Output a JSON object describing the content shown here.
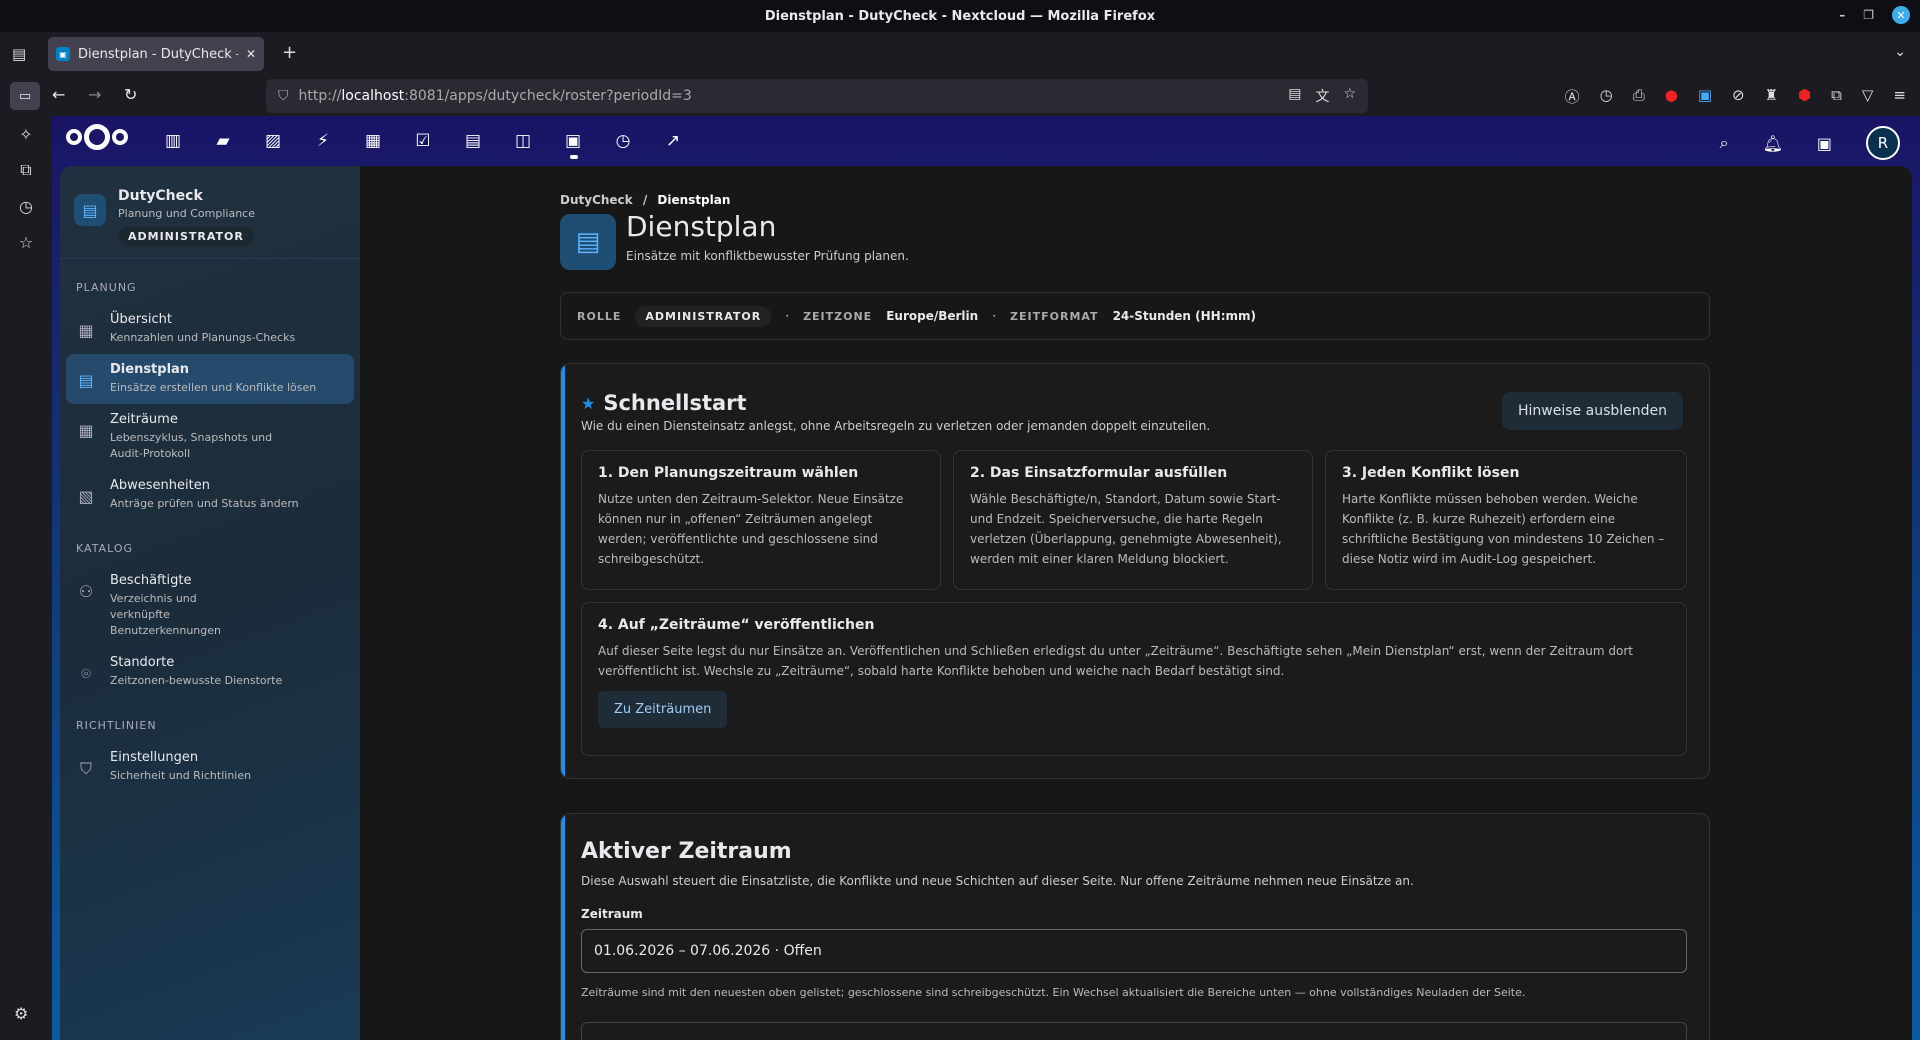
{
  "window": {
    "title": "Dienstplan - DutyCheck - Nextcloud — Mozilla Firefox"
  },
  "browser": {
    "tab_title": "Dienstplan - DutyCheck - Nextcloud",
    "url_prefix": "http://",
    "url_host": "localhost",
    "url_rest": ":8081/apps/dutycheck/roster?periodId=3"
  },
  "app": {
    "name": "DutyCheck",
    "subtitle": "Planung und Compliance",
    "role": "ADMINISTRATOR"
  },
  "sidebar": {
    "sections": {
      "planung": "PLANUNG",
      "katalog": "KATALOG",
      "richtlinien": "RICHTLINIEN"
    },
    "items": [
      {
        "label": "Übersicht",
        "desc": "Kennzahlen und Planungs-Checks"
      },
      {
        "label": "Dienstplan",
        "desc": "Einsätze erstellen und Konflikte lösen"
      },
      {
        "label": "Zeiträume",
        "desc": "Lebenszyklus, Snapshots und Audit-Protokoll"
      },
      {
        "label": "Abwesenheiten",
        "desc": "Anträge prüfen und Status ändern"
      },
      {
        "label": "Beschäftigte",
        "desc": "Verzeichnis und verknüpfte Benutzerkennungen"
      },
      {
        "label": "Standorte",
        "desc": "Zeitzonen-bewusste Dienstorte"
      },
      {
        "label": "Einstellungen",
        "desc": "Sicherheit und Richtlinien"
      }
    ]
  },
  "breadcrumb": {
    "root": "DutyCheck",
    "sep": "/",
    "current": "Dienstplan"
  },
  "page": {
    "title": "Dienstplan",
    "subtitle": "Einsätze mit konfliktbewusster Prüfung planen."
  },
  "rolebar": {
    "role_key": "ROLLE",
    "role_val": "ADMINISTRATOR",
    "tz_key": "ZEITZONE",
    "tz_val": "Europe/Berlin",
    "tf_key": "ZEITFORMAT",
    "tf_val": "24-Stunden (HH:mm)",
    "dot": "·"
  },
  "quickstart": {
    "title": "Schnellstart",
    "subtitle": "Wie du einen Diensteinsatz anlegst, ohne Arbeitsregeln zu verletzen oder jemanden doppelt einzuteilen.",
    "hide_button": "Hinweise ausblenden",
    "steps": [
      {
        "title": "1. Den Planungszeitraum wählen",
        "text": "Nutze unten den Zeitraum-Selektor. Neue Einsätze können nur in „offenen“ Zeiträumen angelegt werden; veröffentlichte und geschlossene sind schreibgeschützt."
      },
      {
        "title": "2. Das Einsatzformular ausfüllen",
        "text": "Wähle Beschäftigte/n, Standort, Datum sowie Start- und Endzeit. Speicherversuche, die harte Regeln verletzen (Überlappung, genehmigte Abwesenheit), werden mit einer klaren Meldung blockiert."
      },
      {
        "title": "3. Jeden Konflikt lösen",
        "text": "Harte Konflikte müssen behoben werden. Weiche Konflikte (z. B. kurze Ruhezeit) erfordern eine schriftliche Bestätigung von mindestens 10 Zeichen – diese Notiz wird im Audit-Log gespeichert."
      },
      {
        "title": "4. Auf „Zeiträume“ veröffentlichen",
        "text": "Auf dieser Seite legst du nur Einsätze an. Veröffentlichen und Schließen erledigst du unter „Zeiträume“. Beschäftigte sehen „Mein Dienstplan“ erst, wenn der Zeitraum dort veröffentlicht ist. Wechsle zu „Zeiträume“, sobald harte Konflikte behoben und weiche nach Bedarf bestätigt sind."
      }
    ],
    "goto_button": "Zu Zeiträumen"
  },
  "active_period": {
    "title": "Aktiver Zeitraum",
    "subtitle": "Diese Auswahl steuert die Einsatzliste, die Konflikte und neue Schichten auf dieser Seite. Nur offene Zeiträume nehmen neue Einsätze an.",
    "label": "Zeitraum",
    "selected": "01.06.2026 – 07.06.2026 · Offen",
    "note": "Zeiträume sind mit den neuesten oben gelistet; geschlossene sind schreibgeschützt. Ein Wechsel aktualisiert die Bereiche unten — ohne vollständiges Neuladen der Seite."
  },
  "avatar_initial": "R",
  "accent": "#1e8fe9"
}
